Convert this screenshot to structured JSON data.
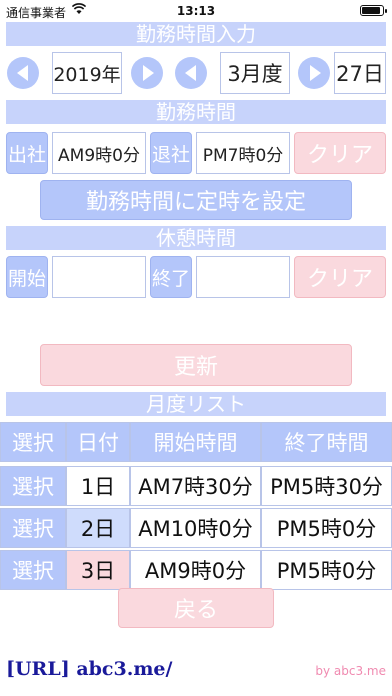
{
  "status_bar": {
    "carrier": "通信事業者",
    "time": "13:13",
    "battery_level": 0.9
  },
  "input_section": {
    "title": "勤務時間入力",
    "year": "2019年",
    "month": "3月度",
    "day": "27日"
  },
  "work_time": {
    "title": "勤務時間",
    "start_label": "出社",
    "start_value": "AM9時0分",
    "end_label": "退社",
    "end_value": "PM7時0分",
    "clear_label": "クリア",
    "set_default_label": "勤務時間に定時を設定"
  },
  "break_time": {
    "title": "休憩時間",
    "start_label": "開始",
    "start_value": "",
    "end_label": "終了",
    "end_value": "",
    "clear_label": "クリア"
  },
  "update_label": "更新",
  "monthly_list": {
    "title": "月度リスト",
    "headers": [
      "選択",
      "日付",
      "開始時間",
      "終了時間"
    ],
    "rows": [
      {
        "select": "選択",
        "date": "1日",
        "start": "AM7時30分",
        "end": "PM5時30分"
      },
      {
        "select": "選択",
        "date": "2日",
        "start": "AM10時0分",
        "end": "PM5時0分"
      },
      {
        "select": "選択",
        "date": "3日",
        "start": "AM9時0分",
        "end": "PM5時0分"
      }
    ]
  },
  "back_label": "戻る",
  "footer": {
    "link": "[URL] abc3.me/",
    "by": "by abc3.me"
  }
}
